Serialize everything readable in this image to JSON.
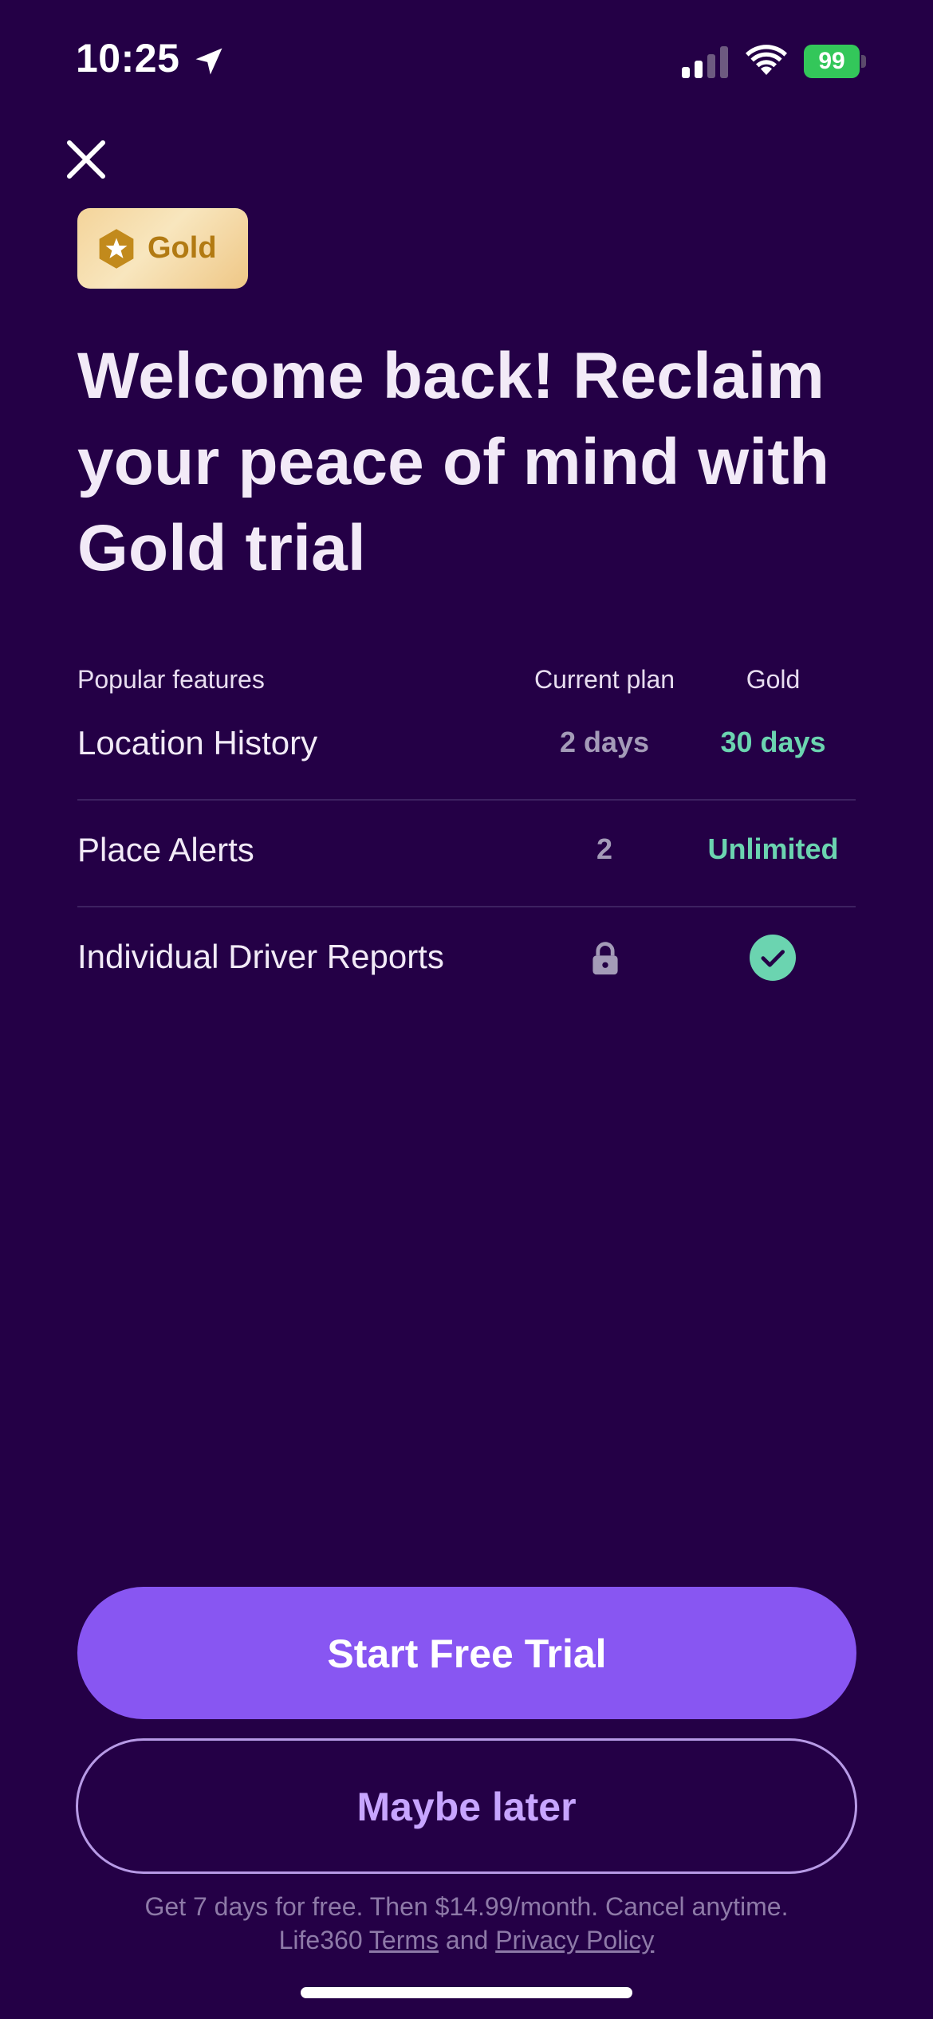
{
  "status_bar": {
    "time": "10:25",
    "battery": "99",
    "battery_color": "#33C75A",
    "icons": [
      "location-arrow-icon",
      "cellular-signal-icon",
      "wifi-icon",
      "battery-icon"
    ]
  },
  "close_icon": "close-icon",
  "badge": {
    "label": "Gold",
    "icon": "star-hexagon-icon"
  },
  "headline": "Welcome back! Reclaim your peace of mind with Gold trial",
  "table": {
    "headers": {
      "feature": "Popular features",
      "current": "Current plan",
      "gold": "Gold"
    },
    "rows": [
      {
        "feature": "Location History",
        "current": "2 days",
        "gold": "30 days"
      },
      {
        "feature": "Place Alerts",
        "current": "2",
        "gold": "Unlimited"
      },
      {
        "feature": "Individual Driver Reports",
        "current_icon": "lock-icon",
        "gold_icon": "check-circle-icon"
      }
    ]
  },
  "buttons": {
    "primary": "Start Free Trial",
    "secondary": "Maybe later"
  },
  "footer": {
    "line1": "Get 7 days for free. Then $14.99/month. Cancel anytime.",
    "prefix": "Life360",
    "terms": "Terms",
    "and": "and",
    "privacy": "Privacy Policy"
  },
  "colors": {
    "background": "#240046",
    "accent": "#8856F2",
    "gold_value": "#6BD4B0",
    "badge_text": "#B27A12"
  }
}
